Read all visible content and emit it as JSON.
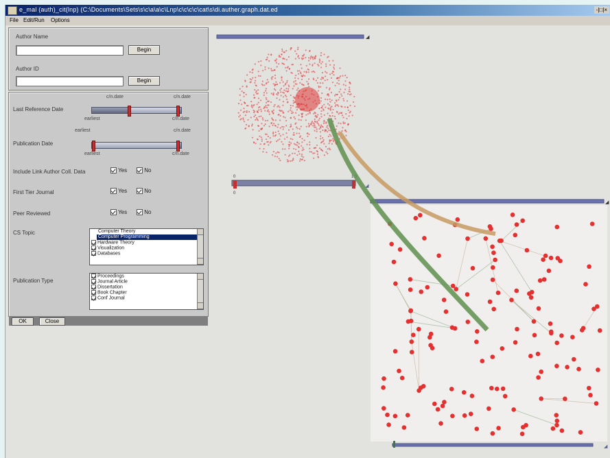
{
  "window": {
    "title": "e_mal (auth)_cit(lnp) (C:\\Documents\\Sets\\s\\c\\a\\a\\c\\Lnp\\c\\c\\c\\c\\cat\\s\\di.auther.graph.dat.ed",
    "controls": "-|□|×"
  },
  "menu": {
    "items": [
      "File",
      "Edit/Run",
      "Options"
    ]
  },
  "search": {
    "author_name_label": "Author Name",
    "author_name_value": "",
    "author_name_button": "Begin",
    "author_id_label": "Author ID",
    "author_id_value": "",
    "author_id_button": "Begin"
  },
  "filters": {
    "citation_date": {
      "label": "Last Reference Date",
      "top_left": "c/n.date",
      "top_right": "c/n.date",
      "bottom_left": "earliest",
      "bottom_right": "c/n.date",
      "range": [
        0.35,
        0.95
      ]
    },
    "publication_date": {
      "label": "Publication Date",
      "top_left": "earliest",
      "top_right": "c/n.date",
      "bottom_left": "earliest",
      "bottom_right": "c/n.date",
      "range": [
        0.0,
        0.95
      ]
    },
    "include_link_author": {
      "label": "Include Link Author Coll. Data",
      "yes": "Yes",
      "no": "No",
      "yes_checked": true,
      "no_checked": true
    },
    "first_tier_journal": {
      "label": "First Tier Journal",
      "yes": "Yes",
      "no": "No",
      "yes_checked": true,
      "no_checked": true
    },
    "peer_reviewed": {
      "label": "Peer Reviewed",
      "yes": "Yes",
      "no": "No",
      "yes_checked": true,
      "no_checked": true
    },
    "cs_topic": {
      "label": "CS Topic",
      "items": [
        "Computer Theory",
        "Computer Programming",
        "Hardware Theory",
        "Visualization",
        "Databases"
      ],
      "selected_index": 1,
      "checked": [
        false,
        false,
        true,
        true,
        true
      ]
    },
    "publication_type": {
      "label": "Publication Type",
      "items": [
        "Proceedings",
        "Journal Article",
        "Dissertation",
        "Book Chapter",
        "Conf Journal"
      ],
      "checked": [
        true,
        true,
        true,
        true,
        true
      ]
    },
    "ok_button": "OK",
    "close_button": "Close"
  },
  "graphs": {
    "overview_slider_left": "0",
    "overview_slider_right": "1.0",
    "overview_slider_sub_left": "0",
    "detail_slider_value": 0.0
  },
  "colors": {
    "node": "#e4302f",
    "edge_green": "#5f8f4f",
    "edge_tan": "#c79a62",
    "accent": "#5a63a0"
  }
}
